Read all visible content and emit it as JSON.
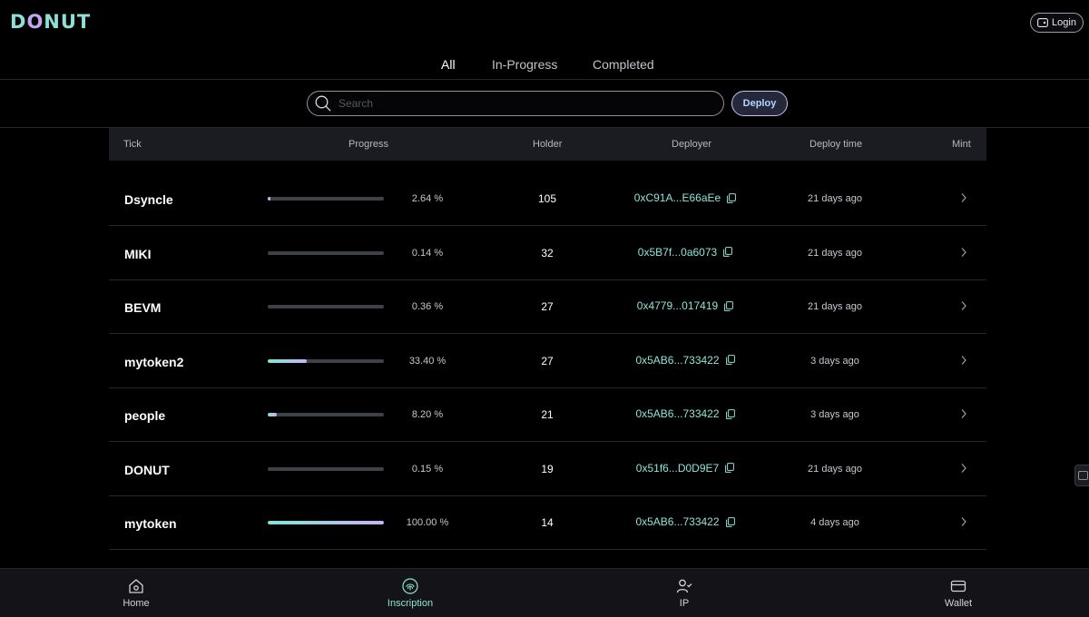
{
  "header": {
    "logo_part1": "D",
    "logo_part2": "O",
    "logo_part3": "NUT",
    "login_label": "Login"
  },
  "tabs": [
    {
      "label": "All",
      "active": true
    },
    {
      "label": "In-Progress",
      "active": false
    },
    {
      "label": "Completed",
      "active": false
    }
  ],
  "search": {
    "placeholder": "Search"
  },
  "deploy_label": "Deploy",
  "table": {
    "columns": [
      "Tick",
      "Progress",
      "Holder",
      "Deployer",
      "Deploy time",
      "Mint"
    ],
    "rows": [
      {
        "tick": "Dsyncle",
        "progress": 2.64,
        "progress_label": "2.64 %",
        "holder": "105",
        "deployer": "0xC91A...E66aEe",
        "time": "21 days ago"
      },
      {
        "tick": "MIKI",
        "progress": 0.14,
        "progress_label": "0.14 %",
        "holder": "32",
        "deployer": "0x5B7f...0a6073",
        "time": "21 days ago"
      },
      {
        "tick": "BEVM",
        "progress": 0.36,
        "progress_label": "0.36 %",
        "holder": "27",
        "deployer": "0x4779...017419",
        "time": "21 days ago"
      },
      {
        "tick": "mytoken2",
        "progress": 33.4,
        "progress_label": "33.40 %",
        "holder": "27",
        "deployer": "0x5AB6...733422",
        "time": "3 days ago"
      },
      {
        "tick": "people",
        "progress": 8.2,
        "progress_label": "8.20 %",
        "holder": "21",
        "deployer": "0x5AB6...733422",
        "time": "3 days ago"
      },
      {
        "tick": "DONUT",
        "progress": 0.15,
        "progress_label": "0.15 %",
        "holder": "19",
        "deployer": "0x51f6...D0D9E7",
        "time": "21 days ago"
      },
      {
        "tick": "mytoken",
        "progress": 100.0,
        "progress_label": "100.00 %",
        "holder": "14",
        "deployer": "0x5AB6...733422",
        "time": "4 days ago"
      }
    ]
  },
  "bottom_nav": [
    {
      "label": "Home",
      "icon": "home-icon",
      "active": false
    },
    {
      "label": "Inscription",
      "icon": "fingerprint-icon",
      "active": true
    },
    {
      "label": "IP",
      "icon": "user-check-icon",
      "active": false
    },
    {
      "label": "Wallet",
      "icon": "wallet-icon",
      "active": false
    }
  ],
  "colors": {
    "accent_teal": "#8fe3d6",
    "accent_lilac": "#c9b3f5",
    "background": "#000000",
    "panel": "#1b1c21"
  }
}
